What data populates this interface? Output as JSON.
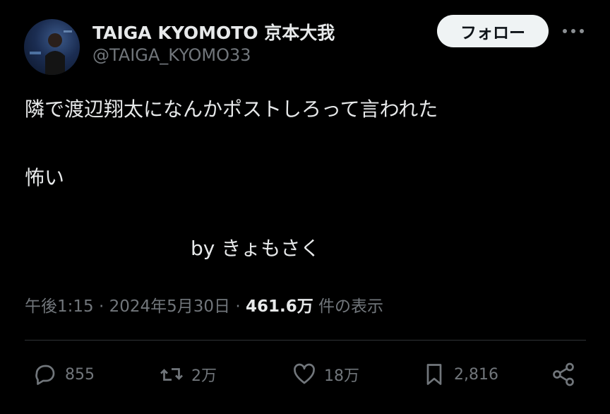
{
  "tweet": {
    "author_name": "TAIGA KYOMOTO 京本大我",
    "author_handle": "@TAIGA_KYOMO33",
    "follow_label": "フォロー",
    "text_line1": "隣で渡辺翔太になんかポストしろって言われた",
    "text_line2": "怖い",
    "text_line3": "by  きょもさく",
    "time": "午後1:15",
    "sep1": " · ",
    "date": "2024年5月30日",
    "sep2": " · ",
    "views_count": "461.6万",
    "views_suffix": " 件の表示"
  },
  "actions": {
    "reply": {
      "icon": "reply-icon",
      "count": "855"
    },
    "retweet": {
      "icon": "retweet-icon",
      "count": "2万"
    },
    "like": {
      "icon": "heart-icon",
      "count": "18万"
    },
    "bookmark": {
      "icon": "bookmark-icon",
      "count": "2,816"
    },
    "share": {
      "icon": "share-icon"
    }
  },
  "colors": {
    "background": "#000000",
    "text": "#e7e9ea",
    "secondary": "#71767b",
    "follow_bg": "#eff3f4"
  }
}
